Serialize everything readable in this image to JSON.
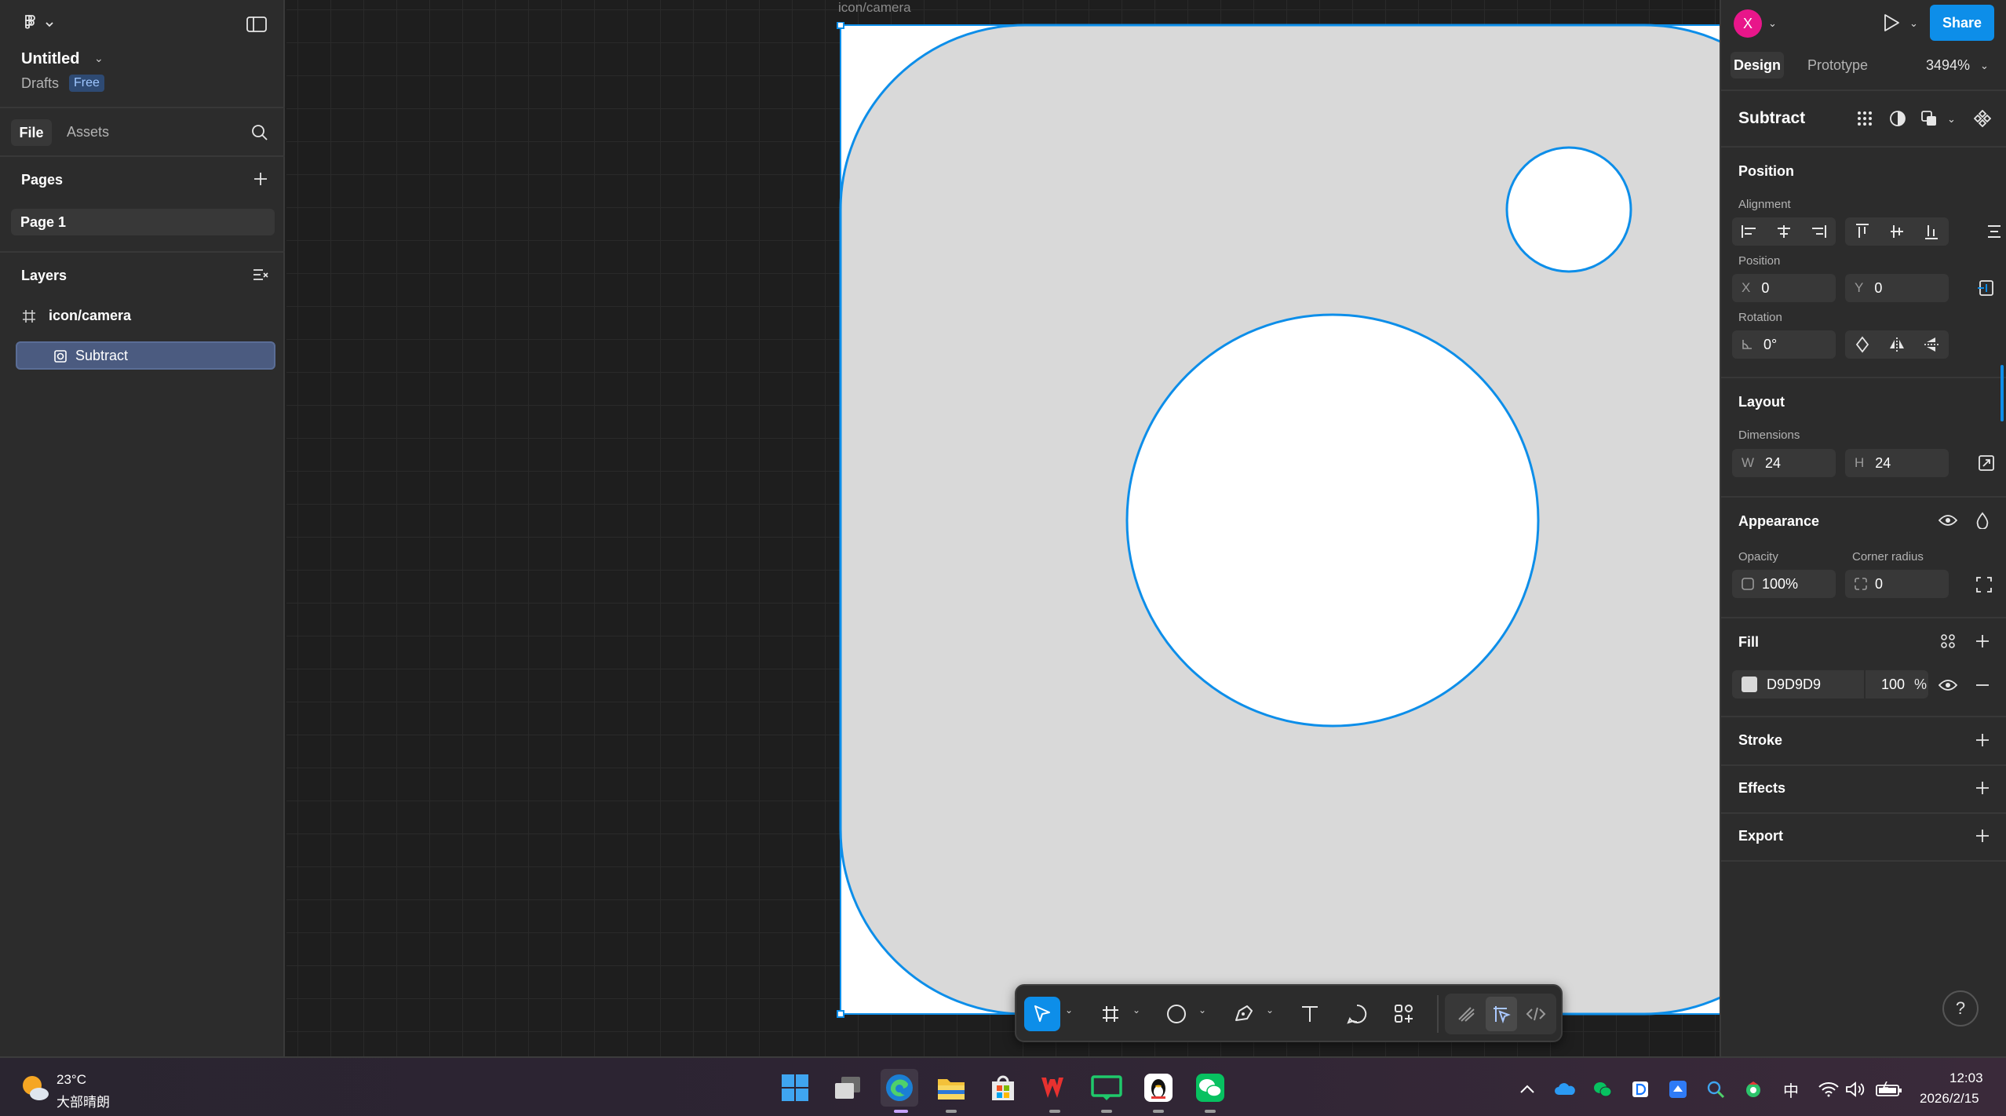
{
  "file": {
    "title": "Untitled",
    "location": "Drafts",
    "plan_badge": "Free"
  },
  "left_tabs": {
    "file": "File",
    "assets": "Assets"
  },
  "pages": {
    "section_title": "Pages",
    "items": [
      "Page 1"
    ]
  },
  "layers": {
    "section_title": "Layers",
    "frame_name": "icon/camera",
    "child_name": "Subtract"
  },
  "canvas": {
    "frame_label": "icon/camera",
    "shape_fill": "#D9D9D9",
    "selection_color": "#0D8EE9"
  },
  "header": {
    "avatar_letter": "X",
    "share_label": "Share",
    "tab_design": "Design",
    "tab_prototype": "Prototype",
    "zoom": "3494%"
  },
  "design": {
    "selection_title": "Subtract",
    "position": {
      "section": "Position",
      "alignment_label": "Alignment",
      "position_label": "Position",
      "x_prefix": "X",
      "x": "0",
      "y_prefix": "Y",
      "y": "0",
      "rotation_label": "Rotation",
      "rotation": "0°"
    },
    "layout": {
      "section": "Layout",
      "dimensions_label": "Dimensions",
      "w_prefix": "W",
      "w": "24",
      "h_prefix": "H",
      "h": "24"
    },
    "appearance": {
      "section": "Appearance",
      "opacity_label": "Opacity",
      "opacity": "100%",
      "corner_label": "Corner radius",
      "corner": "0"
    },
    "fill": {
      "section": "Fill",
      "hex": "D9D9D9",
      "opacity": "100",
      "pct": "%"
    },
    "stroke": {
      "section": "Stroke"
    },
    "effects": {
      "section": "Effects"
    },
    "export": {
      "section": "Export"
    },
    "help": "?"
  },
  "taskbar": {
    "temperature": "23°C",
    "weather": "大部晴朗",
    "ime": "中",
    "time": "12:03",
    "date": "2026/2/15"
  }
}
